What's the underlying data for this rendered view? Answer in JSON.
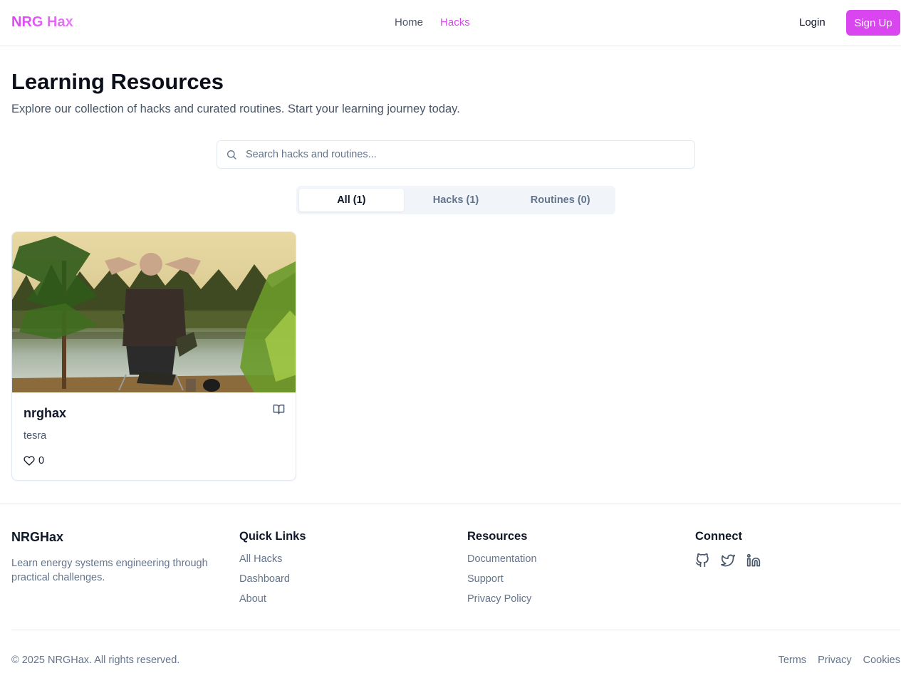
{
  "header": {
    "logo": "NRG Hax",
    "nav": [
      {
        "label": "Home",
        "active": false
      },
      {
        "label": "Hacks",
        "active": true
      }
    ],
    "login_label": "Login",
    "signup_label": "Sign Up",
    "accent_color": "#d946ef"
  },
  "main": {
    "title": "Learning Resources",
    "subtitle": "Explore our collection of hacks and curated routines. Start your learning journey today.",
    "search": {
      "placeholder": "Search hacks and routines..."
    },
    "tabs": [
      {
        "label": "All (1)",
        "active": true
      },
      {
        "label": "Hacks (1)",
        "active": false
      },
      {
        "label": "Routines (0)",
        "active": false
      }
    ],
    "cards": [
      {
        "title": "nrghax",
        "description": "tesra",
        "likes": "0",
        "image": "person-relaxing-by-lake",
        "type_icon": "book-open-icon"
      }
    ]
  },
  "footer": {
    "brand": "NRGHax",
    "description": "Learn energy systems engineering through practical challenges.",
    "quick_links": {
      "title": "Quick Links",
      "items": [
        "All Hacks",
        "Dashboard",
        "About"
      ]
    },
    "resources": {
      "title": "Resources",
      "items": [
        "Documentation",
        "Support",
        "Privacy Policy"
      ]
    },
    "connect": {
      "title": "Connect",
      "icons": [
        "github-icon",
        "twitter-icon",
        "linkedin-icon"
      ]
    },
    "copyright": "© 2025 NRGHax. All rights reserved.",
    "legal": [
      "Terms",
      "Privacy",
      "Cookies"
    ]
  }
}
